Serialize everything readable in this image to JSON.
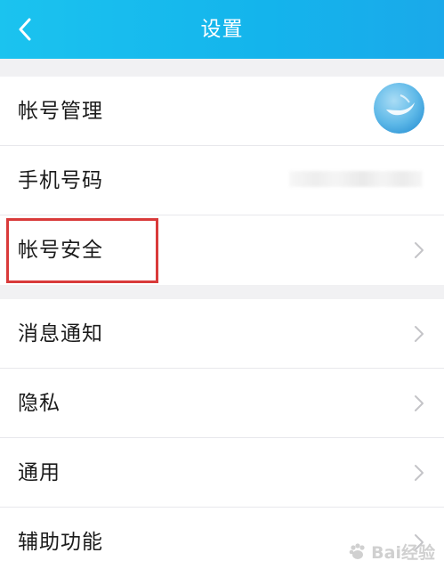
{
  "header": {
    "title": "设置",
    "back_icon": "chevron-left-icon"
  },
  "group1": {
    "items": [
      {
        "label": "帐号管理",
        "accessory": "avatar"
      },
      {
        "label": "手机号码",
        "accessory": "blurred-value"
      },
      {
        "label": "帐号安全",
        "accessory": "chevron-right-icon",
        "highlighted": true
      }
    ]
  },
  "group2": {
    "items": [
      {
        "label": "消息通知",
        "accessory": "chevron-right-icon"
      },
      {
        "label": "隐私",
        "accessory": "chevron-right-icon"
      },
      {
        "label": "通用",
        "accessory": "chevron-right-icon"
      },
      {
        "label": "辅助功能",
        "accessory": "chevron-right-icon"
      }
    ]
  },
  "watermark": {
    "text": "Bai经验"
  },
  "colors": {
    "header_start": "#1bc3ef",
    "header_end": "#1aa9ea",
    "highlight": "#d93a3a",
    "background": "#f1f1f3",
    "chevron": "#c4c4c8"
  }
}
